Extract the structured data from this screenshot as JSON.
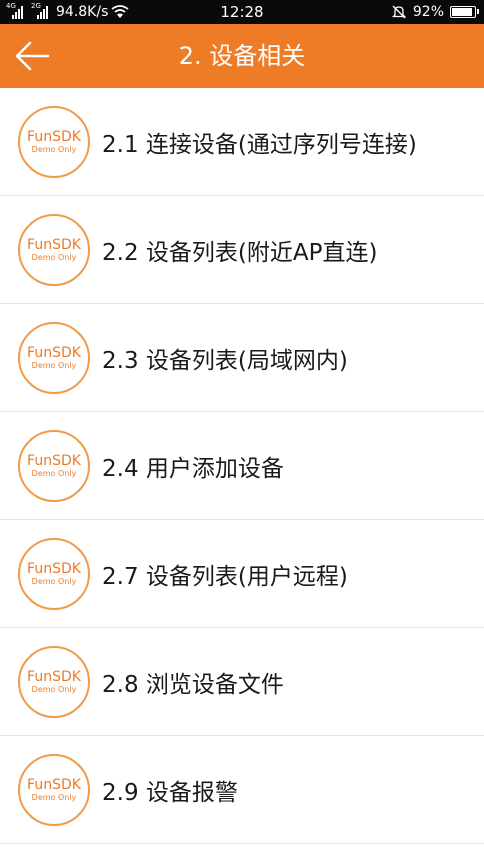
{
  "status_bar": {
    "net_tag_1": "4G",
    "net_tag_2": "2G",
    "speed": "94.8K/s",
    "time": "12:28",
    "battery": "92%",
    "battery_level": 0.92,
    "icons": [
      "signal-icon",
      "wifi-icon",
      "alarm-off-icon",
      "battery-icon"
    ]
  },
  "header": {
    "title": "2. 设备相关",
    "back_icon": "arrow-left-icon",
    "color": "#ee7b26"
  },
  "logo": {
    "main": "FunSDK",
    "sub": "Demo Only",
    "color": "#ee7b26"
  },
  "items": [
    {
      "label": "2.1 连接设备(通过序列号连接)"
    },
    {
      "label": "2.2 设备列表(附近AP直连)"
    },
    {
      "label": "2.3 设备列表(局域网内)"
    },
    {
      "label": "2.4 用户添加设备"
    },
    {
      "label": "2.7 设备列表(用户远程)"
    },
    {
      "label": "2.8 浏览设备文件"
    },
    {
      "label": "2.9 设备报警"
    }
  ]
}
